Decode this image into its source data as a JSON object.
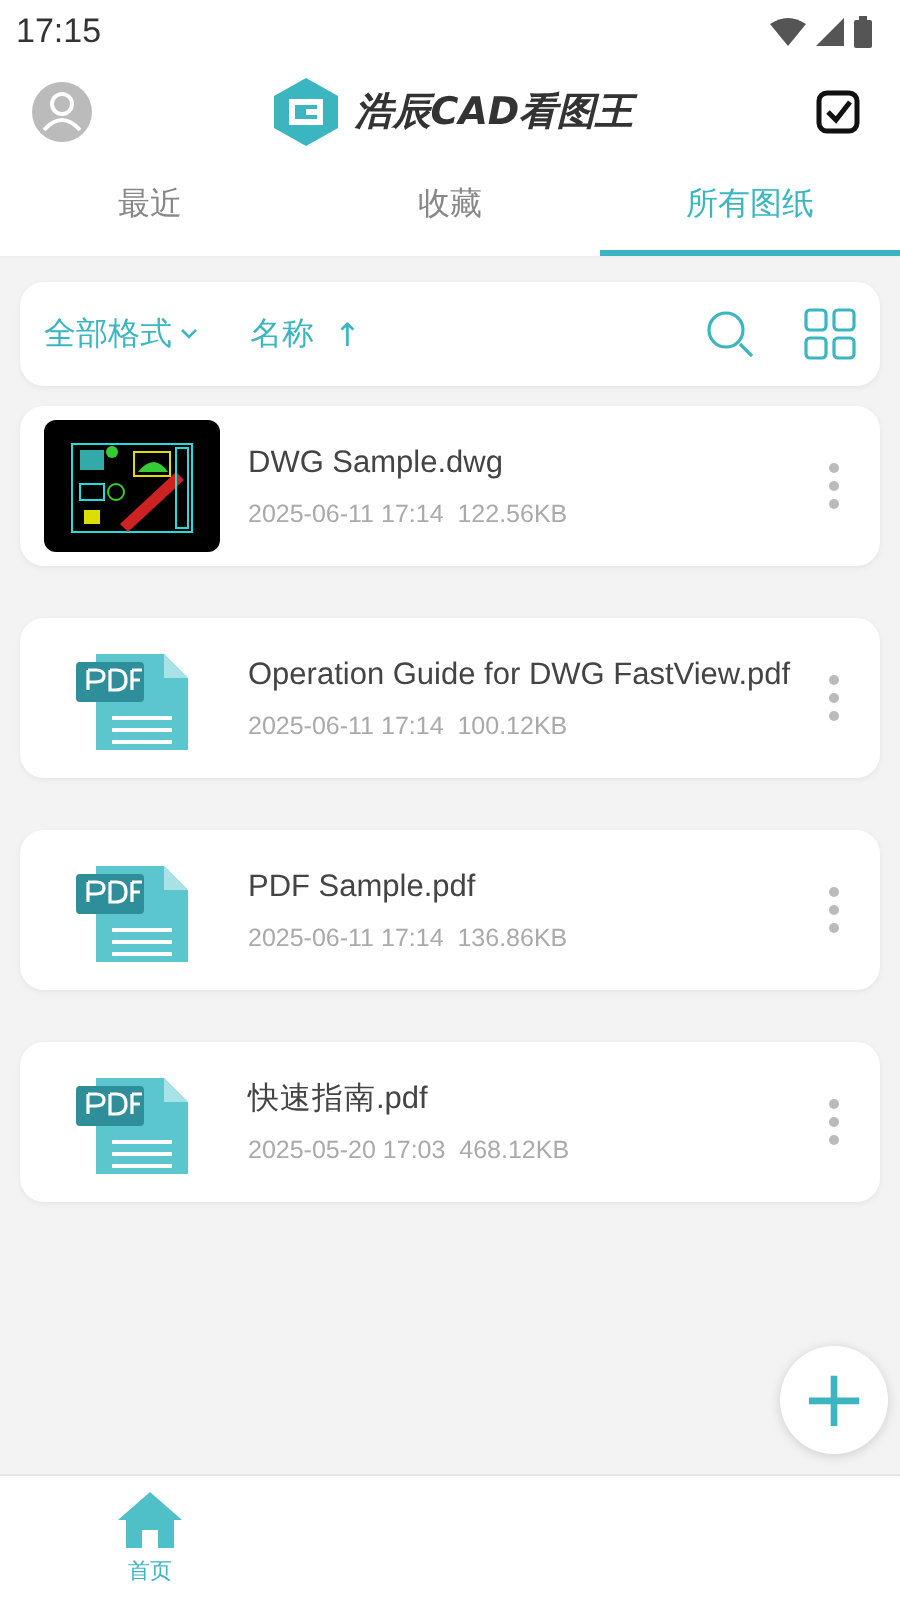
{
  "status_bar": {
    "time": "17:15"
  },
  "header": {
    "app_name": "浩辰CAD看图王"
  },
  "tabs": [
    {
      "label": "最近",
      "selected": false
    },
    {
      "label": "收藏",
      "selected": false
    },
    {
      "label": "所有图纸",
      "selected": true
    }
  ],
  "toolbar": {
    "format_filter": "全部格式",
    "sort": "名称",
    "sort_arrow": "↑"
  },
  "files": [
    {
      "kind": "dwg",
      "name": "DWG Sample.dwg",
      "date": "2025-06-11 17:14",
      "size": "122.56KB"
    },
    {
      "kind": "pdf",
      "name": "Operation Guide for DWG FastView.pdf",
      "date": "2025-06-11 17:14",
      "size": "100.12KB"
    },
    {
      "kind": "pdf",
      "name": "PDF Sample.pdf",
      "date": "2025-06-11 17:14",
      "size": "136.86KB"
    },
    {
      "kind": "pdf",
      "name": "快速指南.pdf",
      "date": "2025-05-20 17:03",
      "size": "468.12KB"
    }
  ],
  "fab": {
    "symbol": "+"
  },
  "bottom_nav": [
    {
      "label": "首页",
      "selected": true
    }
  ]
}
